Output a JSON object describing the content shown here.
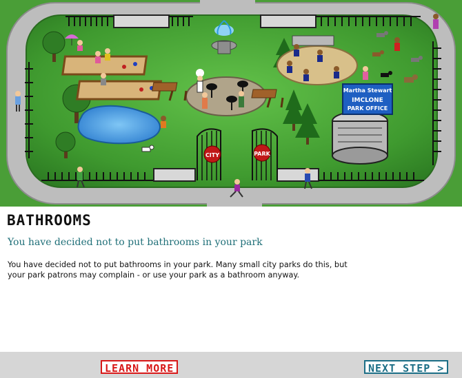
{
  "scene": {
    "office_sign": {
      "line1": "Martha Stewart",
      "line2": "IMCLONE",
      "line3": "PARK OFFICE"
    },
    "gate_left_sign": "CITY",
    "gate_right_sign": "PARK"
  },
  "panel": {
    "heading": "BATHROOMS",
    "subheading": "You have decided not to put bathrooms in your park",
    "body": "You have decided not to put bathrooms in your park. Many small city parks do this, but your park patrons may complain - or use your park as a bathroom anyway."
  },
  "footer": {
    "learn_more_label": "LEARN MORE",
    "next_step_label": "NEXT STEP >"
  },
  "colors": {
    "grass": "#3f9a2f",
    "path": "#bcbcbc",
    "water": "#2f8fd8",
    "heading_accent": "#1f6f78",
    "learn_more": "#d81818",
    "next_step": "#1b6e86",
    "footer_bg": "#d6d6d6"
  }
}
